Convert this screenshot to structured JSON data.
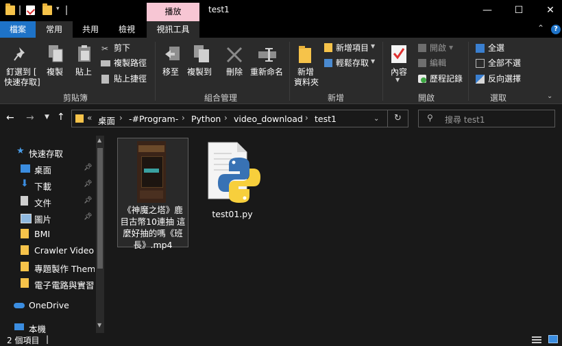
{
  "titlebar": {
    "contextual_tab": "播放",
    "window_title": "test1",
    "minimize": "—",
    "maximize": "☐",
    "close": "✕"
  },
  "ribbon_tabs": {
    "file": "檔案",
    "home": "常用",
    "share": "共用",
    "view": "檢視",
    "video_tools": "視訊工具"
  },
  "ribbon": {
    "clipboard": {
      "pin_line1": "釘選到 [",
      "pin_line2": "快速存取]",
      "copy": "複製",
      "paste": "貼上",
      "cut": "剪下",
      "copy_path": "複製路徑",
      "paste_shortcut": "貼上捷徑",
      "label": "剪貼簿"
    },
    "organize": {
      "move_to": "移至",
      "copy_to": "複製到",
      "delete": "刪除",
      "rename": "重新命名",
      "label": "組合管理"
    },
    "new": {
      "new_folder_line1": "新增",
      "new_folder_line2": "資料夾",
      "new_item": "新增項目",
      "easy_access": "輕鬆存取",
      "label": "新增"
    },
    "open": {
      "properties": "內容",
      "open": "開啟",
      "edit": "編輯",
      "history": "歷程記錄",
      "label": "開啟"
    },
    "select": {
      "select_all": "全選",
      "select_none": "全部不選",
      "invert": "反向選擇",
      "label": "選取"
    }
  },
  "navbar": {
    "breadcrumb": [
      "桌面",
      "-#Program-",
      "Python",
      "video_download",
      "test1"
    ],
    "overflow": "«",
    "search_placeholder": "搜尋 test1"
  },
  "sidebar": {
    "quick_access": "快速存取",
    "items": [
      {
        "label": "桌面",
        "icon": "desktop-icon",
        "pinned": true
      },
      {
        "label": "下載",
        "icon": "download-icon",
        "pinned": true
      },
      {
        "label": "文件",
        "icon": "documents-icon",
        "pinned": true
      },
      {
        "label": "圖片",
        "icon": "pictures-icon",
        "pinned": true
      },
      {
        "label": "BMI",
        "icon": "folder-icon",
        "pinned": false
      },
      {
        "label": "Crawler Video",
        "icon": "folder-icon",
        "pinned": false
      },
      {
        "label": "專題製作 Thema",
        "icon": "folder-icon",
        "pinned": false
      },
      {
        "label": "電子電路與實習",
        "icon": "folder-icon",
        "pinned": false
      }
    ],
    "onedrive": "OneDrive",
    "this_pc": "本機"
  },
  "files": [
    {
      "name": "《神魔之塔》鹿\n目古幣10連抽 這\n麼好抽的嗎《班\n長》.mp4",
      "type": "video"
    },
    {
      "name": "test01.py",
      "type": "python"
    }
  ],
  "statusbar": {
    "count": "2 個項目",
    "cursor": "|"
  },
  "colors": {
    "accent": "#1e73c8",
    "contextual_tab": "#f7c6d4",
    "folder": "#f6c34a"
  }
}
